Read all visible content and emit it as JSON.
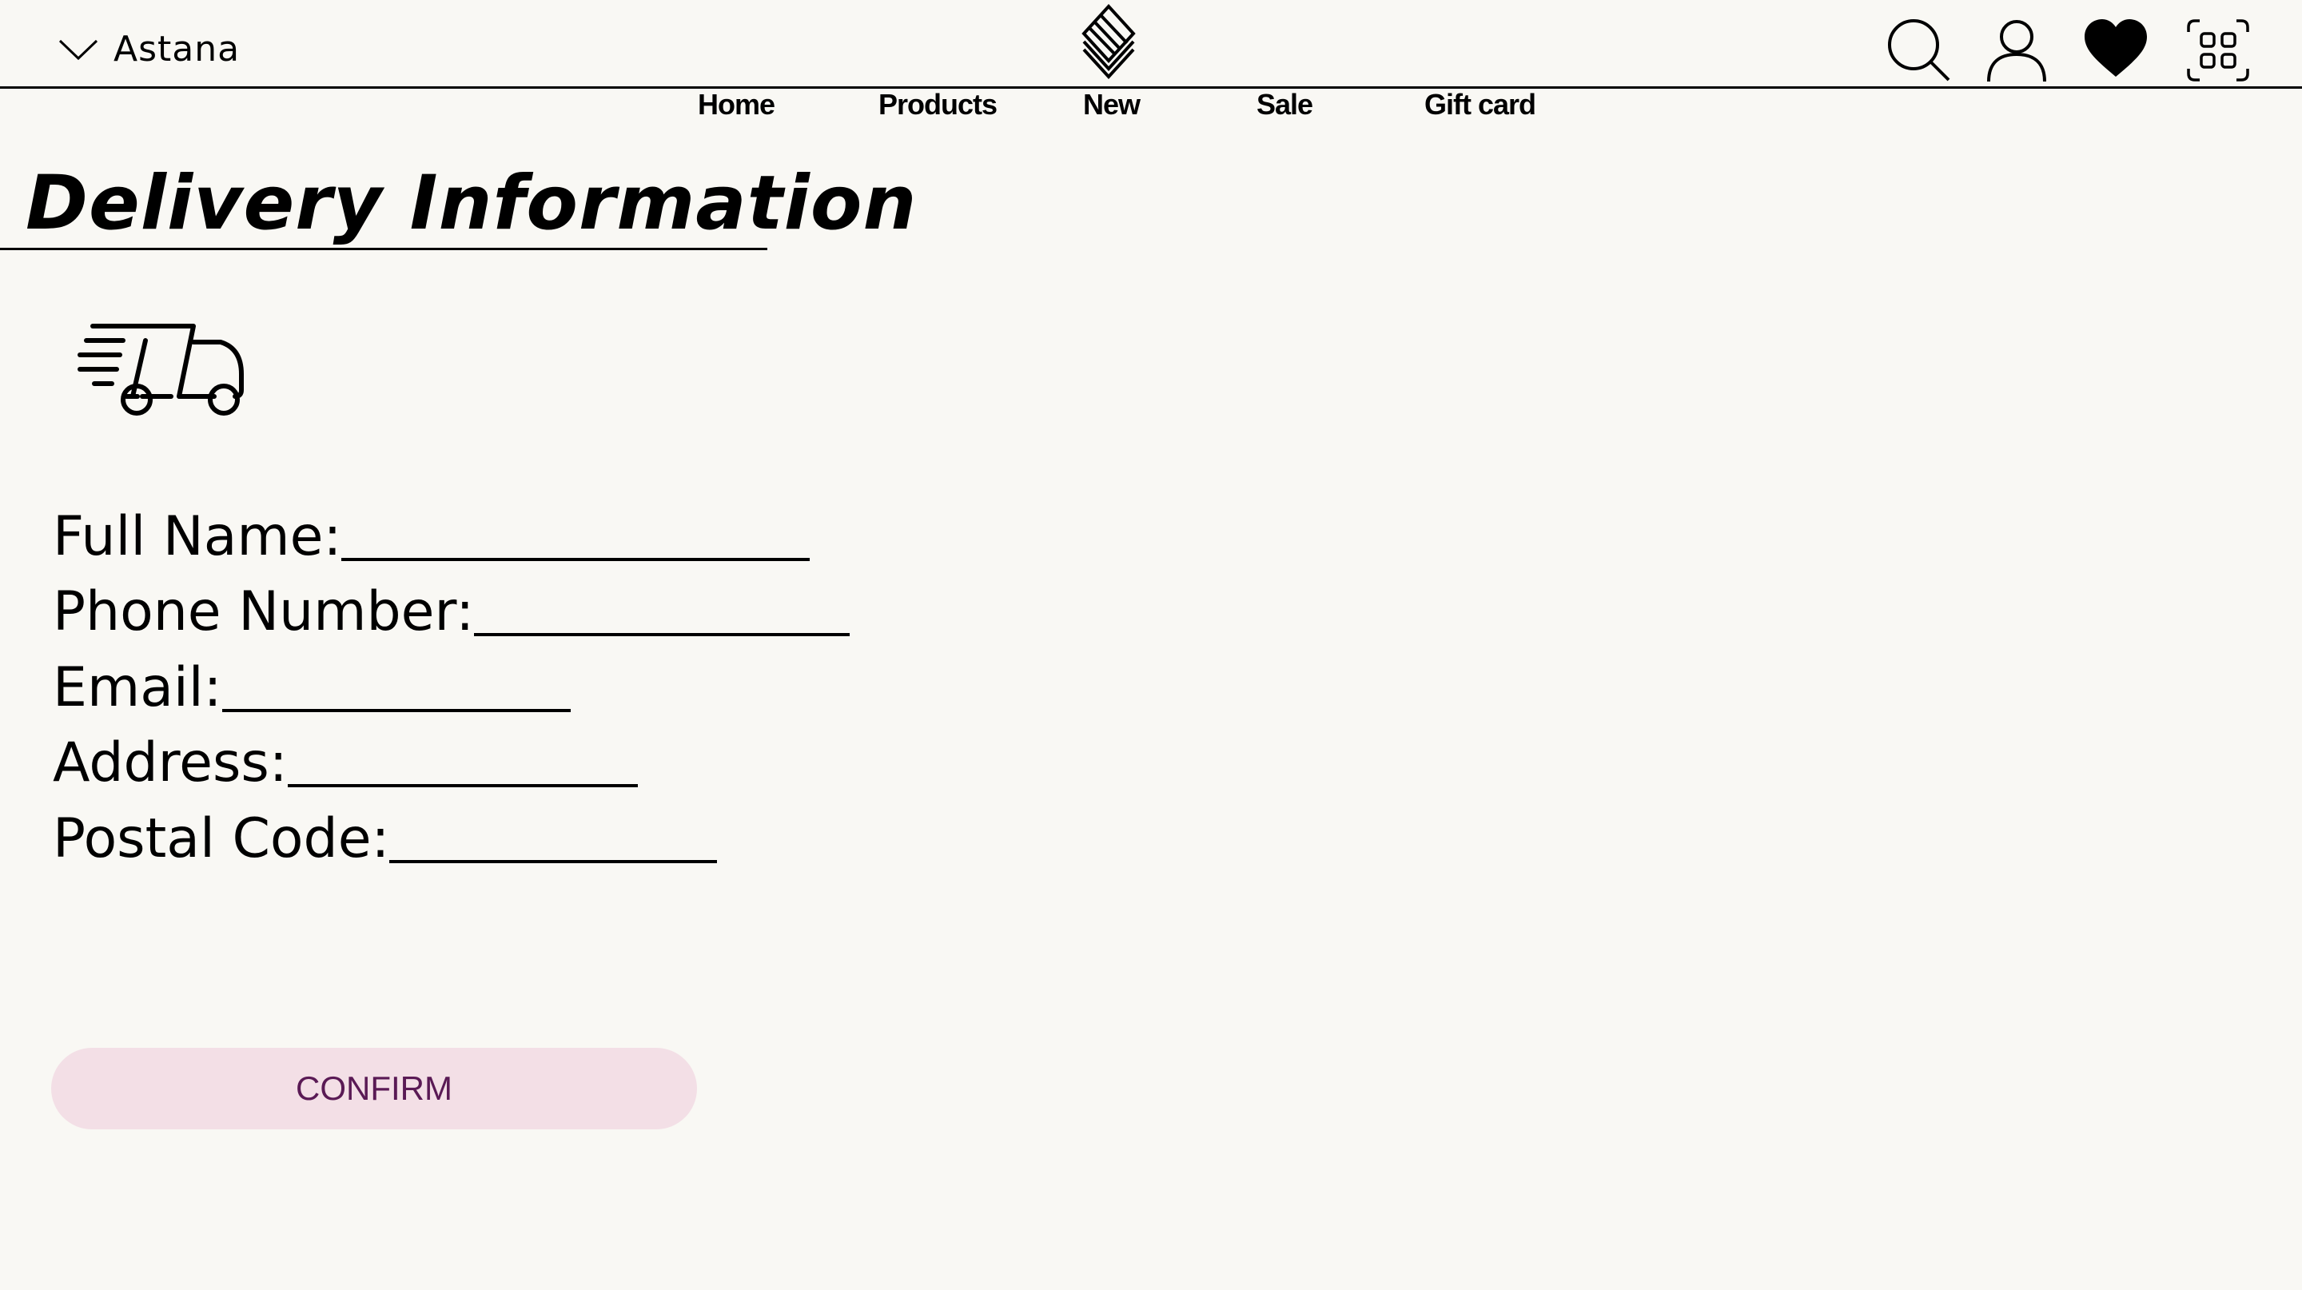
{
  "header": {
    "city": "Astana",
    "icons": [
      "chevron-down-icon",
      "brand-logo",
      "search-icon",
      "user-icon",
      "heart-icon",
      "grid-menu-icon"
    ]
  },
  "nav": {
    "items": [
      {
        "label": "Home"
      },
      {
        "label": "Products"
      },
      {
        "label": "New"
      },
      {
        "label": "Sale"
      },
      {
        "label": "Gift card"
      }
    ]
  },
  "page": {
    "title": "Delivery Information",
    "truck_icon": "delivery-truck-icon"
  },
  "form": {
    "fields": [
      {
        "label": "Full Name: "
      },
      {
        "label": "Phone Number: "
      },
      {
        "label": "Email:"
      },
      {
        "label": "Address:"
      },
      {
        "label": "Postal Code:"
      }
    ],
    "confirm_label": "CONFIRM"
  },
  "colors": {
    "background": "#f9f8f4",
    "button_bg": "#f3dfe6",
    "button_text": "#5a1a55",
    "text": "#000000"
  }
}
